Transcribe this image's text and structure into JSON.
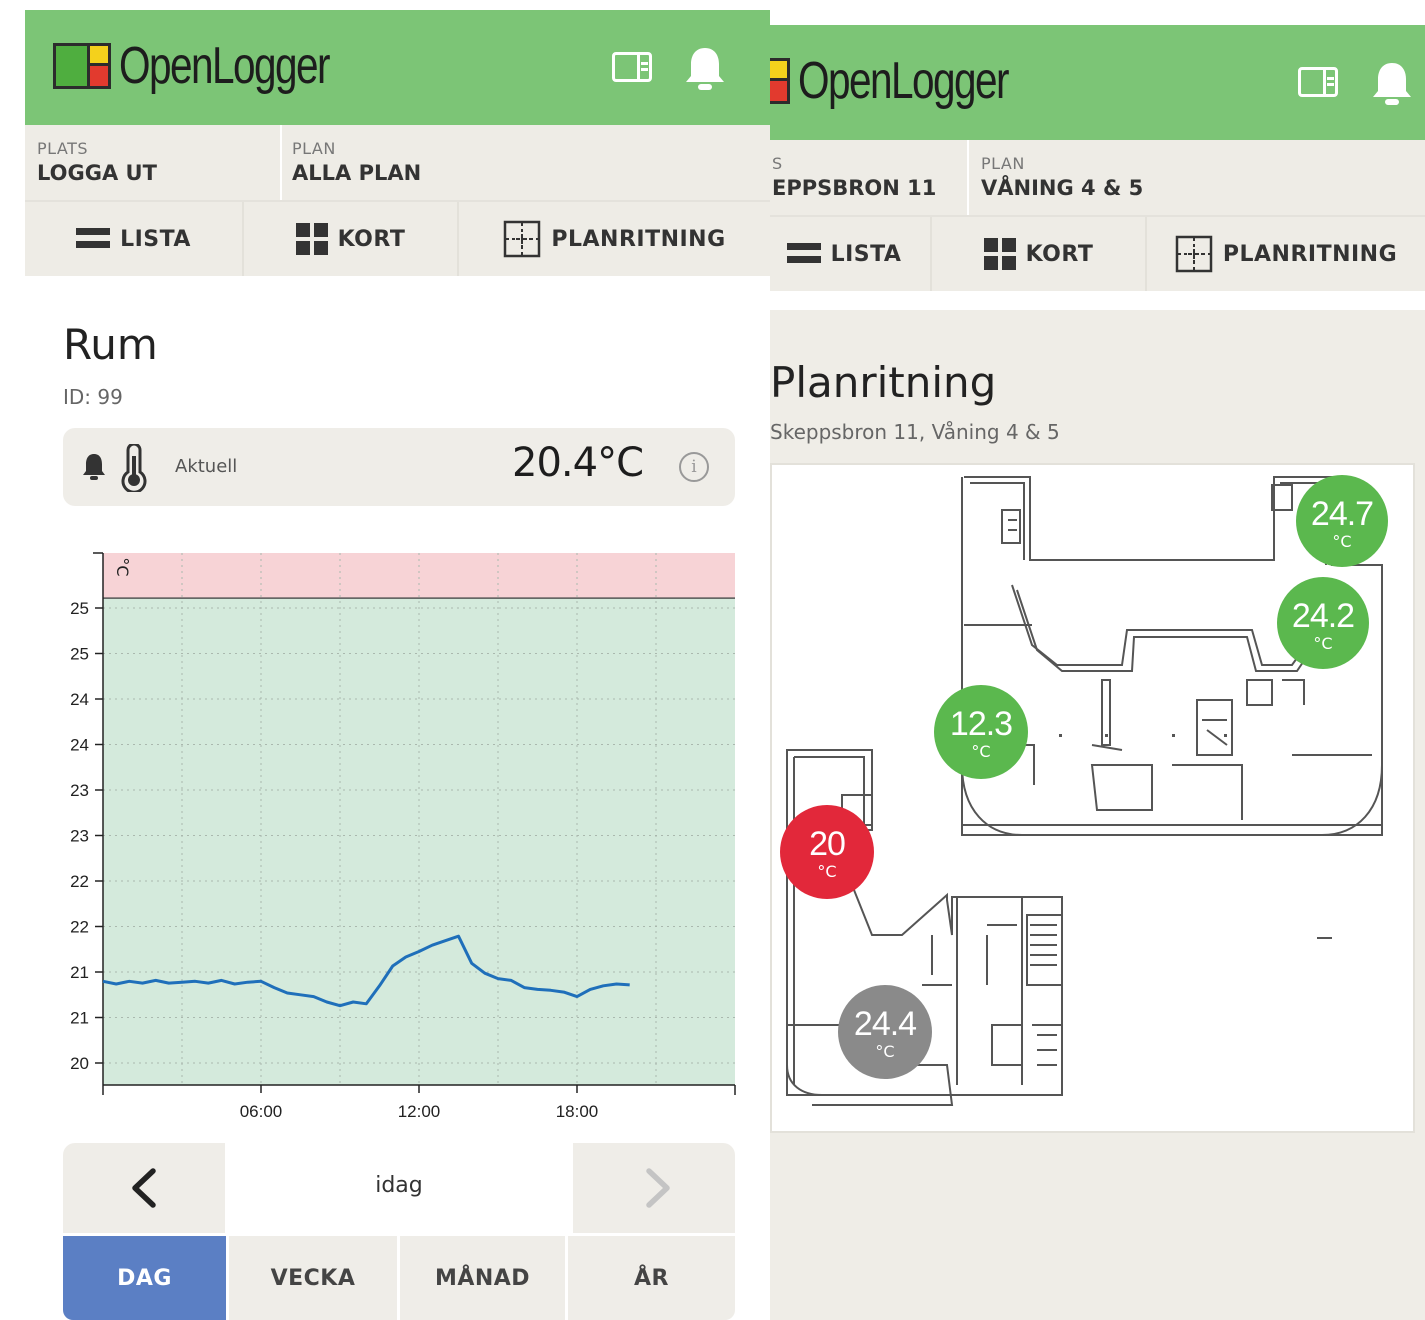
{
  "left": {
    "app_name": "OpenLogger",
    "subbar": {
      "plats_label": "PLATS",
      "plats_value": "LOGGA UT",
      "plan_label": "PLAN",
      "plan_value": "ALLA PLAN"
    },
    "tabs": {
      "list": "LISTA",
      "card": "KORT",
      "floorplan": "PLANRITNING"
    },
    "title": "Rum",
    "id_text": "ID: 99",
    "current": {
      "label": "Aktuell",
      "value": "20.4°C"
    },
    "pager": {
      "label": "idag"
    },
    "periods": {
      "day": "DAG",
      "week": "VECKA",
      "month": "MÅNAD",
      "year": "ÅR"
    }
  },
  "right": {
    "app_name": "OpenLogger",
    "subbar": {
      "plats_label": "S",
      "plats_value": "EPPSBRON 11",
      "plan_label": "PLAN",
      "plan_value": "VÅNING 4 & 5"
    },
    "tabs": {
      "list": "LISTA",
      "card": "KORT",
      "floorplan": "PLANRITNING"
    },
    "title": "Planritning",
    "subtitle": "Skeppsbron 11, Våning 4 & 5",
    "sensors": [
      {
        "value": "24.7",
        "unit": "°C",
        "status": "ok",
        "color": "#5bb84e"
      },
      {
        "value": "24.2",
        "unit": "°C",
        "status": "ok",
        "color": "#5bb84e"
      },
      {
        "value": "12.3",
        "unit": "°C",
        "status": "ok",
        "color": "#5bb84e"
      },
      {
        "value": "20",
        "unit": "°C",
        "status": "alarm",
        "color": "#e2283a"
      },
      {
        "value": "24.4",
        "unit": "°C",
        "status": "offline",
        "color": "#8a8a8a"
      }
    ]
  },
  "colors": {
    "header_green": "#7cc576",
    "alarm_zone": "#f7d3d6",
    "ok_zone": "#d4eadc",
    "series": "#1f6fba",
    "active_period": "#5b7fc4"
  },
  "chart_data": {
    "type": "line",
    "ylabel": "°C",
    "ytick_labels": [
      "25",
      "25",
      "24",
      "24",
      "23",
      "23",
      "22",
      "22",
      "21",
      "21",
      "20"
    ],
    "xtick_labels": [
      "06:00",
      "12:00",
      "18:00"
    ],
    "xlim": [
      0,
      24
    ],
    "ylim": [
      19.6,
      25.5
    ],
    "alarm_threshold": 25.0,
    "grid": true,
    "series": [
      {
        "x": [
          0,
          0.5,
          1,
          1.5,
          2,
          2.5,
          3,
          3.5,
          4,
          4.5,
          5,
          5.5,
          6,
          6.5,
          7,
          7.5,
          8,
          8.5,
          9,
          9.5,
          10,
          10.5,
          11,
          11.5,
          12,
          12.5,
          13,
          13.5,
          14,
          14.5,
          15,
          15.5,
          16,
          16.5,
          17,
          17.5,
          18,
          18.5,
          19,
          19.5,
          20
        ],
        "y": [
          20.75,
          20.72,
          20.75,
          20.73,
          20.76,
          20.73,
          20.74,
          20.75,
          20.73,
          20.76,
          20.72,
          20.74,
          20.75,
          20.68,
          20.62,
          20.6,
          20.58,
          20.52,
          20.48,
          20.52,
          20.5,
          20.7,
          20.92,
          21.02,
          21.08,
          21.15,
          21.2,
          21.25,
          20.95,
          20.84,
          20.78,
          20.76,
          20.68,
          20.66,
          20.65,
          20.63,
          20.58,
          20.66,
          20.7,
          20.72,
          20.71
        ]
      }
    ]
  }
}
